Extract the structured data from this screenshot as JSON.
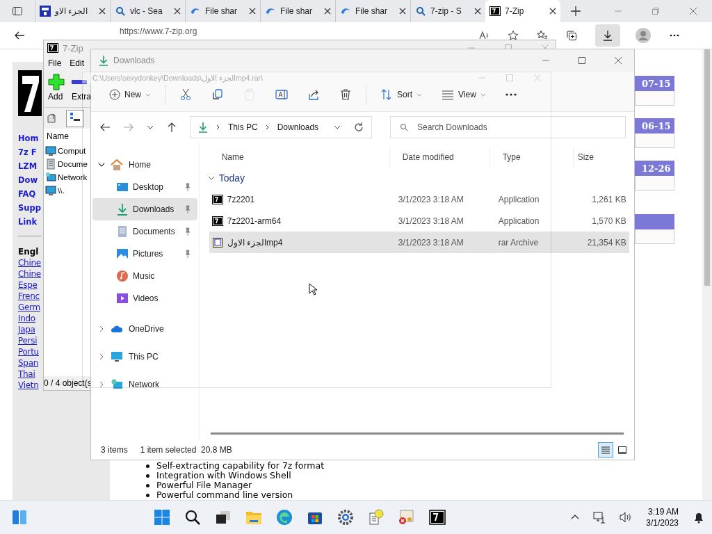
{
  "browser": {
    "tabs": [
      {
        "label": "الجزء الاو",
        "kind": "mf",
        "selected": false
      },
      {
        "label": "vlc - Sea",
        "kind": "search",
        "selected": false
      },
      {
        "label": "File shar",
        "kind": "share",
        "selected": false
      },
      {
        "label": "File shar",
        "kind": "share",
        "selected": false
      },
      {
        "label": "File shar",
        "kind": "share",
        "selected": false
      },
      {
        "label": "7-zip - S",
        "kind": "search",
        "selected": false
      },
      {
        "label": "7-Zip",
        "kind": "sevenzip",
        "selected": true
      }
    ],
    "address": "https://www.7-zip.org",
    "page": {
      "nav": [
        "Hom",
        "7z F",
        "LZM",
        "Dow",
        "FAQ",
        "Supp",
        "Link"
      ],
      "language_heading": "Engl",
      "languages": [
        "Chine",
        "Chine",
        "Espe",
        "Frenc",
        "Germ",
        "Indo",
        "Japa",
        "Persi",
        "Portu",
        "Span",
        "Thai",
        "Vietn"
      ],
      "dates": [
        "07-15",
        "06-15",
        "12-26"
      ],
      "features": [
        "Self-extracting capability for 7z format",
        "Integration with Windows Shell",
        "Powerful File Manager",
        "Powerful command line version"
      ]
    }
  },
  "sevenzip": {
    "title": "7-Zip",
    "menu": [
      "File",
      "Edit"
    ],
    "toolbar": [
      {
        "kind": "add",
        "label": "Add"
      },
      {
        "kind": "extract",
        "label": "Extra"
      }
    ],
    "column": "Name",
    "items": [
      {
        "kind": "computer",
        "label": "Comput"
      },
      {
        "kind": "document",
        "label": "Docume"
      },
      {
        "kind": "network",
        "label": "Network"
      },
      {
        "kind": "computer",
        "label": "\\\\."
      }
    ],
    "status": "0 / 4 object(s"
  },
  "ghost": {
    "title": "C:\\Users\\sexydonkey\\Downloads\\الجزء الاولmp4.rar\\"
  },
  "explorer": {
    "title": "Downloads",
    "toolbar": [
      {
        "kind": "new",
        "label": "New",
        "disabled": false
      },
      {
        "kind": "cut",
        "disabled": false
      },
      {
        "kind": "copy",
        "disabled": false
      },
      {
        "kind": "paste",
        "disabled": true
      },
      {
        "kind": "rename",
        "disabled": false
      },
      {
        "kind": "share",
        "disabled": false
      },
      {
        "kind": "delete",
        "disabled": false
      },
      {
        "kind": "sort",
        "label": "Sort",
        "disabled": false
      },
      {
        "kind": "view",
        "label": "View",
        "disabled": false
      },
      {
        "kind": "more",
        "disabled": false
      }
    ],
    "breadcrumb": [
      "This PC",
      "Downloads"
    ],
    "search_placeholder": "Search Downloads",
    "sidebar": [
      {
        "label": "Home",
        "kind": "home",
        "expanded": true,
        "selected": false,
        "children": [
          {
            "label": "Desktop",
            "kind": "desktop",
            "pinned": true,
            "selected": false
          },
          {
            "label": "Downloads",
            "kind": "downloads",
            "pinned": true,
            "selected": true
          },
          {
            "label": "Documents",
            "kind": "documents",
            "pinned": true,
            "selected": false
          },
          {
            "label": "Pictures",
            "kind": "pictures",
            "pinned": true,
            "selected": false
          },
          {
            "label": "Music",
            "kind": "music",
            "pinned": false,
            "selected": false
          },
          {
            "label": "Videos",
            "kind": "videos",
            "pinned": false,
            "selected": false
          }
        ]
      },
      {
        "label": "OneDrive",
        "kind": "cloud",
        "expanded": false,
        "selected": false
      },
      {
        "label": "This PC",
        "kind": "pc",
        "expanded": false,
        "selected": false
      },
      {
        "label": "Network",
        "kind": "network",
        "expanded": false,
        "selected": false
      }
    ],
    "columns": [
      "Name",
      "Date modified",
      "Type",
      "Size"
    ],
    "group": "Today",
    "rows": [
      {
        "kind": "app",
        "name": "7z2201",
        "date": "3/1/2023 3:18 AM",
        "type": "Application",
        "size": "1,261 KB",
        "selected": false
      },
      {
        "kind": "app",
        "name": "7z2201-arm64",
        "date": "3/1/2023 3:18 AM",
        "type": "Application",
        "size": "1,570 KB",
        "selected": false
      },
      {
        "kind": "archive",
        "name": "الجزء الاولmp4",
        "date": "3/1/2023 3:18 AM",
        "type": "rar Archive",
        "size": "21,354 KB",
        "selected": true
      }
    ],
    "status": {
      "count": "3 items",
      "selection": "1 item selected  20.8 MB"
    },
    "views": [
      {
        "kind": "details",
        "selected": true
      },
      {
        "kind": "tiles",
        "selected": false
      }
    ]
  },
  "taskbar": {
    "time": "3:19 AM",
    "date": "3/1/2023"
  }
}
